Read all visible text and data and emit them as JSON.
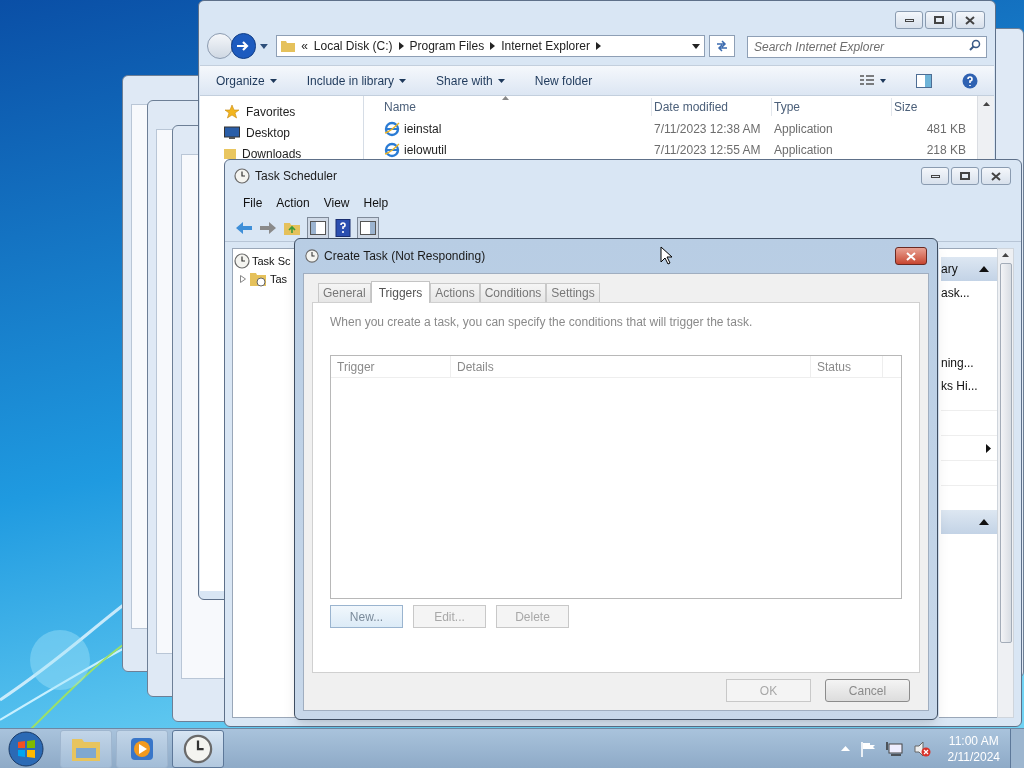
{
  "explorer": {
    "overflow": "«",
    "breadcrumb": [
      "Local Disk (C:)",
      "Program Files",
      "Internet Explorer"
    ],
    "search": {
      "placeholder": "Search Internet Explorer"
    },
    "toolbar": [
      "Organize",
      "Include in library",
      "Share with",
      "New folder"
    ],
    "nav": [
      {
        "label": "Favorites",
        "kind": "star"
      },
      {
        "label": "Desktop",
        "kind": "desktop"
      },
      {
        "label": "Downloads",
        "kind": "download"
      }
    ],
    "columns": [
      "Name",
      "Date modified",
      "Type",
      "Size"
    ],
    "rows": [
      {
        "name": "ieinstal",
        "date": "7/11/2023 12:38 AM",
        "type": "Application",
        "size": "481 KB"
      },
      {
        "name": "ielowutil",
        "date": "7/11/2023 12:55 AM",
        "type": "Application",
        "size": "218 KB"
      }
    ]
  },
  "task_scheduler": {
    "title": "Task Scheduler",
    "menu": [
      "File",
      "Action",
      "View",
      "Help"
    ],
    "tree": [
      {
        "label": "Task Sc",
        "children": [
          {
            "label": "Tas",
            "expanded": false
          }
        ]
      }
    ],
    "actions_header": "ary",
    "actions": [
      "ask...",
      "ning...",
      "ks Hi..."
    ]
  },
  "dialog": {
    "title": "Create Task (Not Responding)",
    "tabs": [
      {
        "label": "General",
        "selected": false
      },
      {
        "label": "Triggers",
        "selected": true
      },
      {
        "label": "Actions",
        "selected": false
      },
      {
        "label": "Conditions",
        "selected": false
      },
      {
        "label": "Settings",
        "selected": false
      }
    ],
    "description": "When you create a task, you can specify the conditions that will trigger the task.",
    "columns": [
      "Trigger",
      "Details",
      "Status"
    ],
    "buttons": [
      {
        "label": "New...",
        "disabled": false
      },
      {
        "label": "Edit...",
        "disabled": true
      },
      {
        "label": "Delete",
        "disabled": true
      }
    ],
    "footer_buttons": [
      {
        "label": "OK",
        "disabled": true
      },
      {
        "label": "Cancel",
        "disabled": false
      }
    ]
  },
  "taskbar": {
    "apps": [
      {
        "kind": "folder",
        "selected": false
      },
      {
        "kind": "media",
        "selected": false
      },
      {
        "kind": "clock",
        "selected": true
      }
    ],
    "time": "11:00 AM",
    "date": "2/11/2024"
  }
}
